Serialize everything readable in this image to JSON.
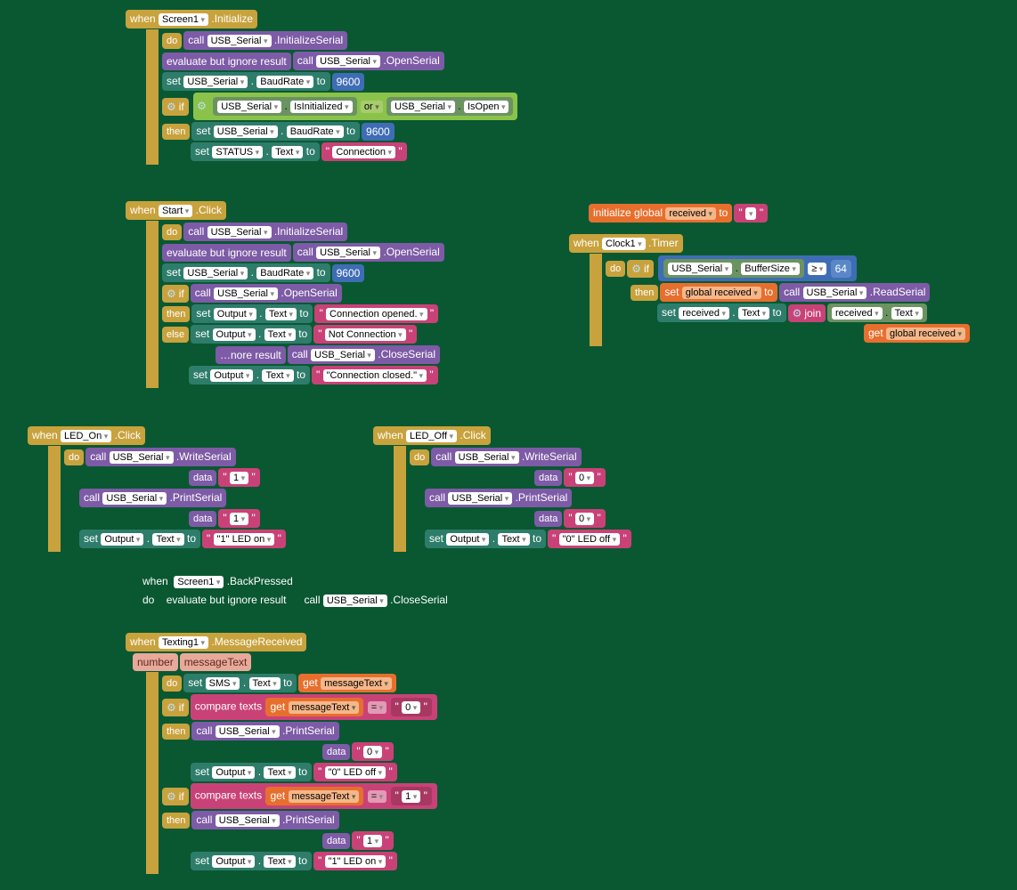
{
  "kw": {
    "when": "when",
    "do": "do",
    "call": "call",
    "set": "set",
    "if": "if",
    "then": "then",
    "else": "else",
    "to": "to",
    "or": "or",
    "get": "get",
    "join": "join",
    "data": "data",
    "evalign": "evaluate but ignore result",
    "compare": "compare texts",
    "initglobal": "initialize global",
    "number": "number",
    "messageText": "messageText"
  },
  "comp": {
    "Screen1": "Screen1",
    "USB_Serial": "USB_Serial",
    "Start": "Start",
    "Output": "Output",
    "STATUS": "STATUS",
    "LED_On": "LED_On",
    "LED_Off": "LED_Off",
    "Texting1": "Texting1",
    "SMS": "SMS",
    "Clock1": "Clock1",
    "received": "received",
    "global_received": "global received"
  },
  "prop": {
    "Initialize": ".Initialize",
    "InitializeSerial": ".InitializeSerial",
    "OpenSerial": ".OpenSerial",
    "CloseSerial": ".CloseSerial",
    "BaudRate": "BaudRate",
    "IsInitialized": "IsInitialized",
    "IsOpen": "IsOpen",
    "Text": "Text",
    "Click": ".Click",
    "WriteSerial": ".WriteSerial",
    "PrintSerial": ".PrintSerial",
    "BackPressed": ".BackPressed",
    "MessageReceived": ".MessageReceived",
    "Timer": ".Timer",
    "BufferSize": "BufferSize",
    "ReadSerial": ".ReadSerial"
  },
  "val": {
    "baud": "9600",
    "conn": "Connection",
    "connOpened": "Connection opened.",
    "notConn": "Not Connection",
    "connClosed": "\"Connection closed.\"",
    "one": "1",
    "zero": "0",
    "ledOn": "\"1\" LED on",
    "ledOff": "\"0\" LED off",
    "empty": "",
    "ge": "≥",
    "eq": "=",
    "sixtyfour": "64"
  }
}
